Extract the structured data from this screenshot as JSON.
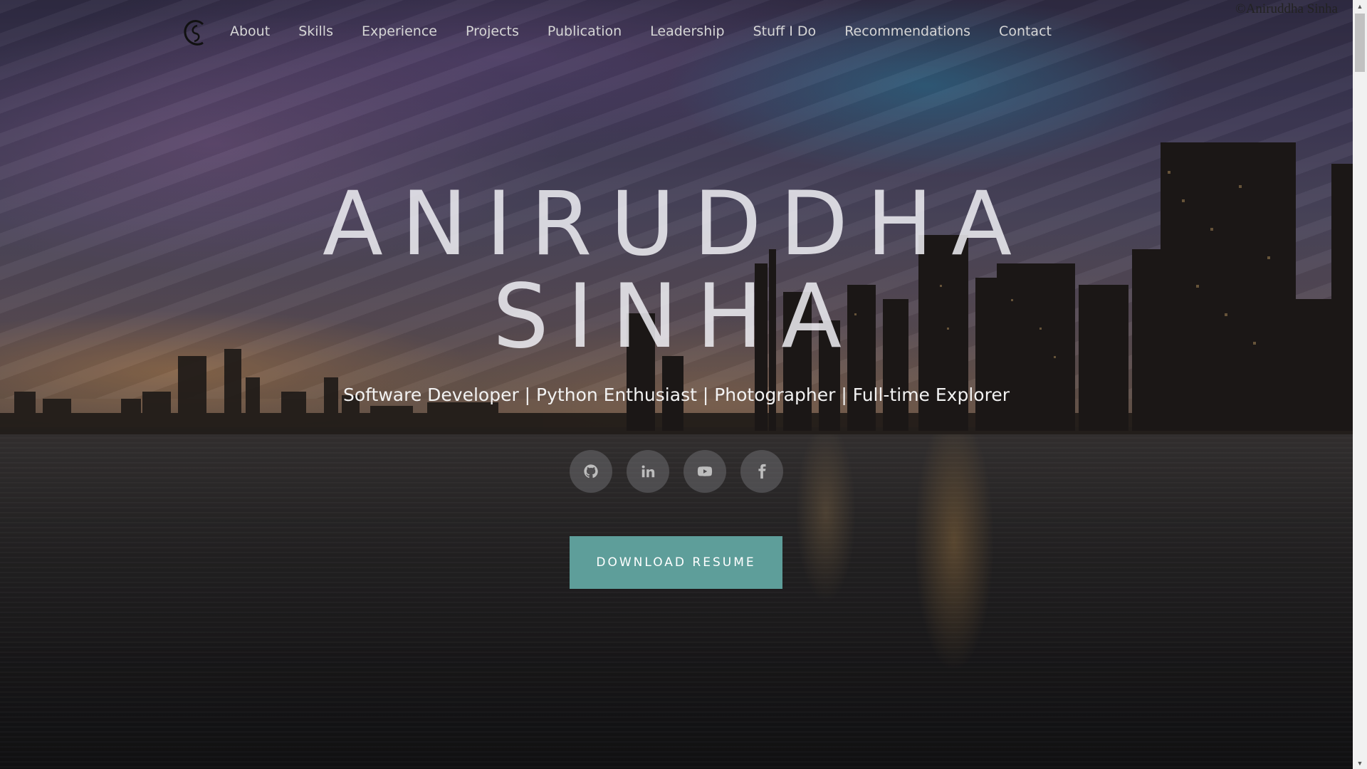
{
  "header": {
    "nav": [
      {
        "label": "About"
      },
      {
        "label": "Skills"
      },
      {
        "label": "Experience"
      },
      {
        "label": "Projects"
      },
      {
        "label": "Publication"
      },
      {
        "label": "Leadership"
      },
      {
        "label": "Stuff I Do"
      },
      {
        "label": "Recommendations"
      },
      {
        "label": "Contact"
      }
    ],
    "copyright": "©Aniruddha Sinha"
  },
  "hero": {
    "name_line1": "ANIRUDDHA",
    "name_line2": "SINHA",
    "tagline": "Software Developer | Python Enthusiast | Photographer | Full-time Explorer",
    "socials": [
      {
        "icon": "github-icon"
      },
      {
        "icon": "linkedin-icon"
      },
      {
        "icon": "youtube-icon"
      },
      {
        "icon": "facebook-icon"
      }
    ],
    "resume_button": "DOWNLOAD RESUME"
  },
  "colors": {
    "accent": "#5e9e9a",
    "nav_text": "#d6d6d6",
    "social_bg": "#78787d"
  }
}
